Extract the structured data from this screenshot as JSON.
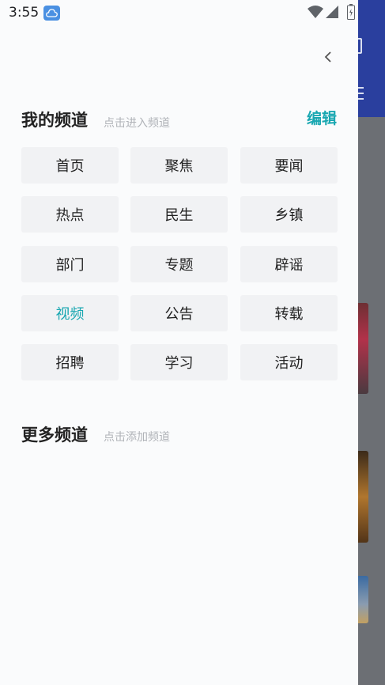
{
  "status_bar": {
    "time": "3:55",
    "icons": [
      "cloud-icon",
      "wifi-icon",
      "signal-icon",
      "battery-icon"
    ]
  },
  "drawer": {
    "back_icon": "chevron-left-icon",
    "my_channels": {
      "title": "我的频道",
      "hint": "点击进入频道",
      "edit_label": "编辑",
      "channels": [
        "首页",
        "聚焦",
        "要闻",
        "热点",
        "民生",
        "乡镇",
        "部门",
        "专题",
        "辟谣",
        "视频",
        "公告",
        "转载",
        "招聘",
        "学习",
        "活动"
      ],
      "active": "视频"
    },
    "more_channels": {
      "title": "更多频道",
      "hint": "点击添加频道"
    }
  },
  "colors": {
    "accent": "#19a7b1",
    "chip_bg": "#f1f2f4",
    "background": "#fafbfc"
  }
}
